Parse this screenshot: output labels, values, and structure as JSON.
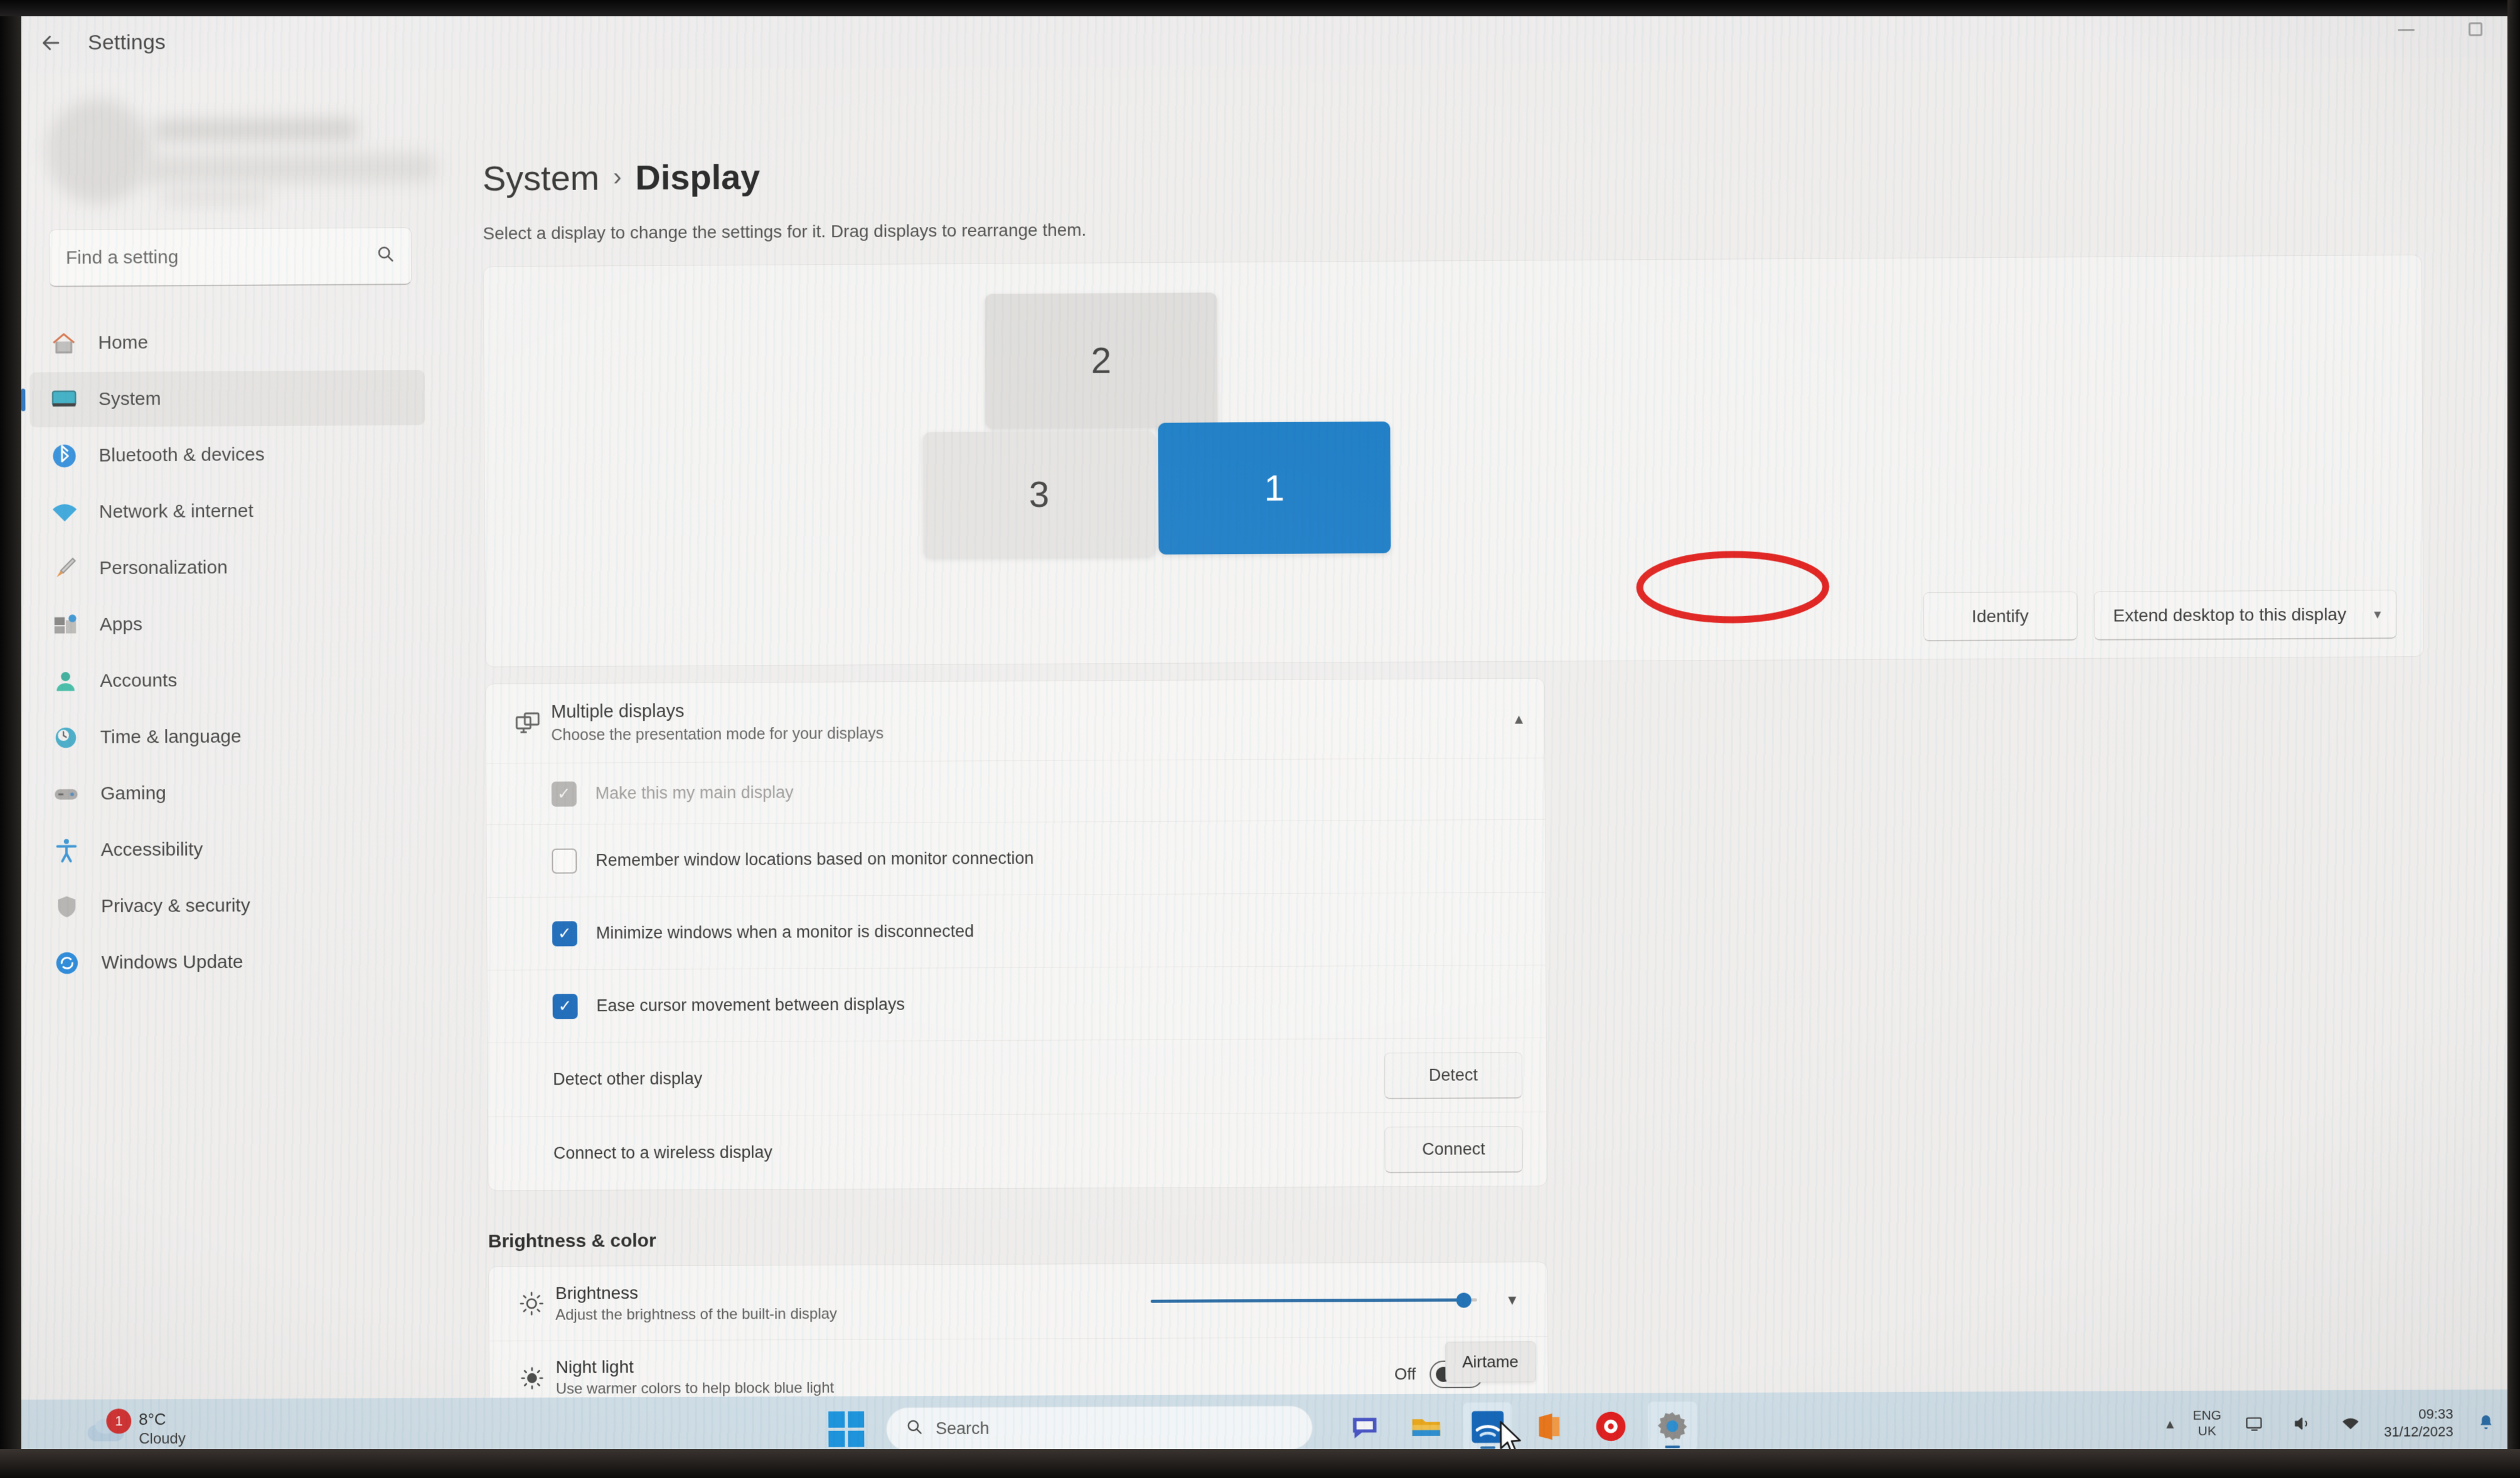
{
  "window": {
    "title": "Settings",
    "back_icon": "back-arrow-icon",
    "minimize_label": "Minimize",
    "restore_label": "Restore"
  },
  "sidebar": {
    "search": {
      "placeholder": "Find a setting",
      "value": "",
      "icon": "search-icon"
    },
    "items": [
      {
        "label": "Home",
        "icon": "home-icon",
        "selected": false
      },
      {
        "label": "System",
        "icon": "system-icon",
        "selected": true
      },
      {
        "label": "Bluetooth & devices",
        "icon": "bluetooth-icon",
        "selected": false
      },
      {
        "label": "Network & internet",
        "icon": "network-icon",
        "selected": false
      },
      {
        "label": "Personalization",
        "icon": "paintbrush-icon",
        "selected": false
      },
      {
        "label": "Apps",
        "icon": "apps-icon",
        "selected": false
      },
      {
        "label": "Accounts",
        "icon": "accounts-icon",
        "selected": false
      },
      {
        "label": "Time & language",
        "icon": "clock-globe-icon",
        "selected": false
      },
      {
        "label": "Gaming",
        "icon": "gamepad-icon",
        "selected": false
      },
      {
        "label": "Accessibility",
        "icon": "accessibility-icon",
        "selected": false
      },
      {
        "label": "Privacy & security",
        "icon": "shield-icon",
        "selected": false
      },
      {
        "label": "Windows Update",
        "icon": "windows-update-icon",
        "selected": false
      }
    ]
  },
  "page": {
    "breadcrumb_parent": "System",
    "breadcrumb_sep": "›",
    "breadcrumb_current": "Display",
    "subtitle": "Select a display to change the settings for it. Drag displays to rearrange them."
  },
  "arrangement": {
    "monitors": [
      {
        "number": "2",
        "selected": false
      },
      {
        "number": "3",
        "selected": false
      },
      {
        "number": "1",
        "selected": true
      }
    ],
    "identify_button": "Identify",
    "projection_mode": "Extend desktop to this display",
    "dropdown_icon": "chevron-down-icon",
    "selected_color": "#1277c4",
    "annotation": {
      "shape": "ellipse",
      "color": "#e01b18",
      "target": "Identify"
    }
  },
  "multiple_displays": {
    "icon": "multiple-displays-icon",
    "title": "Multiple displays",
    "subtitle": "Choose the presentation mode for your displays",
    "collapse_icon": "chevron-up-icon",
    "checkboxes": [
      {
        "label": "Make this my main display",
        "checked": true,
        "disabled": true
      },
      {
        "label": "Remember window locations based on monitor connection",
        "checked": false,
        "disabled": false
      },
      {
        "label": "Minimize windows when a monitor is disconnected",
        "checked": true,
        "disabled": false
      },
      {
        "label": "Ease cursor movement between displays",
        "checked": true,
        "disabled": false
      }
    ],
    "actions": [
      {
        "label": "Detect other display",
        "button": "Detect"
      },
      {
        "label": "Connect to a wireless display",
        "button": "Connect"
      }
    ]
  },
  "brightness_color": {
    "heading": "Brightness & color",
    "brightness": {
      "icon": "brightness-icon",
      "title": "Brightness",
      "subtitle": "Adjust the brightness of the built-in display",
      "value_percent": 96,
      "expand_icon": "chevron-down-icon"
    },
    "night_light": {
      "icon": "night-light-icon",
      "title": "Night light",
      "subtitle": "Use warmer colors to help block blue light",
      "state": "Off",
      "chevron_icon": "chevron-right-icon"
    }
  },
  "tooltip": {
    "text": "Airtame"
  },
  "taskbar": {
    "weather": {
      "temp": "8°C",
      "condition": "Cloudy",
      "badge": "1",
      "icon": "cloud-icon"
    },
    "start_icon": "windows-start-icon",
    "search": {
      "placeholder": "Search",
      "icon": "search-icon"
    },
    "apps": [
      {
        "name": "chat-icon",
        "active": false
      },
      {
        "name": "file-explorer-icon",
        "active": false
      },
      {
        "name": "airtame-icon",
        "active": true
      },
      {
        "name": "office-icon",
        "active": false
      },
      {
        "name": "media-player-icon",
        "active": false
      },
      {
        "name": "settings-gear-icon",
        "active": true
      }
    ],
    "tray": {
      "overflow_icon": "chevron-up-icon",
      "language_line1": "ENG",
      "language_line2": "UK",
      "icons": [
        "monitor-icon",
        "volume-icon",
        "network-icon"
      ],
      "time": "09:33",
      "date": "31/12/2023",
      "notification_icon": "bell-icon"
    }
  }
}
